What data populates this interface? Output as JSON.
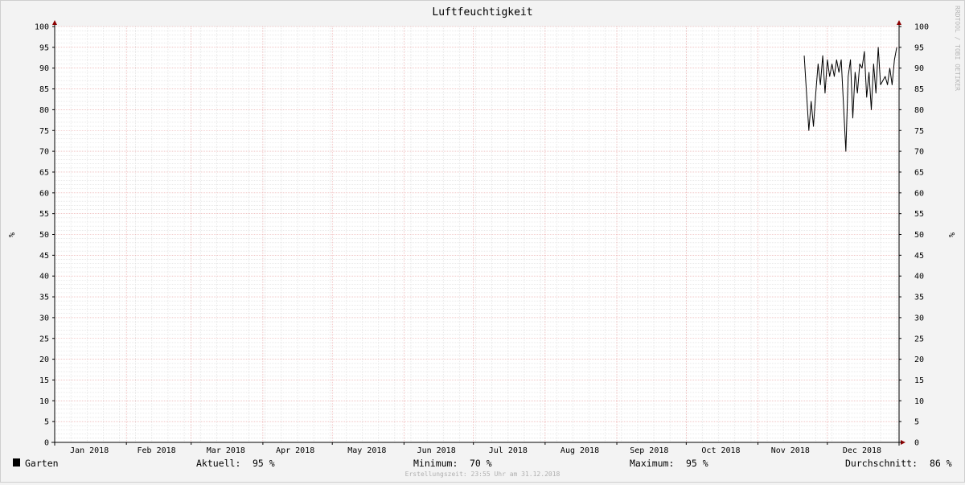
{
  "chart_data": {
    "type": "line",
    "title": "Luftfeuchtigkeit",
    "ylabel": "%",
    "ylabel_right": "%",
    "ylim": [
      0,
      100
    ],
    "yticks": [
      0,
      5,
      10,
      15,
      20,
      25,
      30,
      35,
      40,
      45,
      50,
      55,
      60,
      65,
      70,
      75,
      80,
      85,
      90,
      95,
      100
    ],
    "x_range": [
      "2018-01-01",
      "2019-01-01"
    ],
    "x_ticks": [
      {
        "label": "Jan 2018",
        "date": "2018-01-16"
      },
      {
        "label": "Feb 2018",
        "date": "2018-02-14"
      },
      {
        "label": "Mar 2018",
        "date": "2018-03-16"
      },
      {
        "label": "Apr 2018",
        "date": "2018-04-15"
      },
      {
        "label": "May 2018",
        "date": "2018-05-16"
      },
      {
        "label": "Jun 2018",
        "date": "2018-06-15"
      },
      {
        "label": "Jul 2018",
        "date": "2018-07-16"
      },
      {
        "label": "Aug 2018",
        "date": "2018-08-16"
      },
      {
        "label": "Sep 2018",
        "date": "2018-09-15"
      },
      {
        "label": "Oct 2018",
        "date": "2018-10-16"
      },
      {
        "label": "Nov 2018",
        "date": "2018-11-15"
      },
      {
        "label": "Dec 2018",
        "date": "2018-12-16"
      }
    ],
    "month_starts": [
      "2018-02-01",
      "2018-03-01",
      "2018-04-01",
      "2018-05-01",
      "2018-06-01",
      "2018-07-01",
      "2018-08-01",
      "2018-09-01",
      "2018-10-01",
      "2018-11-01",
      "2018-12-01"
    ],
    "grid": true,
    "series": [
      {
        "name": "Garten",
        "color": "#000000",
        "x": [
          "2018-11-21",
          "2018-11-22",
          "2018-11-23",
          "2018-11-24",
          "2018-11-25",
          "2018-11-26",
          "2018-11-27",
          "2018-11-28",
          "2018-11-29",
          "2018-11-30",
          "2018-12-01",
          "2018-12-02",
          "2018-12-03",
          "2018-12-04",
          "2018-12-05",
          "2018-12-06",
          "2018-12-07",
          "2018-12-08",
          "2018-12-09",
          "2018-12-10",
          "2018-12-11",
          "2018-12-12",
          "2018-12-13",
          "2018-12-14",
          "2018-12-15",
          "2018-12-16",
          "2018-12-17",
          "2018-12-18",
          "2018-12-19",
          "2018-12-20",
          "2018-12-21",
          "2018-12-22",
          "2018-12-23",
          "2018-12-24",
          "2018-12-25",
          "2018-12-26",
          "2018-12-27",
          "2018-12-28",
          "2018-12-29",
          "2018-12-30",
          "2018-12-31"
        ],
        "values": [
          93,
          84,
          75,
          82,
          76,
          84,
          91,
          86,
          93,
          84,
          92,
          88,
          91,
          88,
          92,
          89,
          92,
          81,
          70,
          88,
          92,
          78,
          89,
          84,
          91,
          90,
          94,
          83,
          89,
          80,
          91,
          84,
          95,
          86,
          87,
          88,
          86,
          90,
          86,
          92,
          95
        ]
      }
    ]
  },
  "legend": {
    "series_name": "Garten",
    "swatch_color": "#000000",
    "aktuell_label": "Aktuell:",
    "aktuell_value": "95 %",
    "minimum_label": "Minimum:",
    "minimum_value": "70 %",
    "maximum_label": "Maximum:",
    "maximum_value": "95 %",
    "durchschnitt_label": "Durchschnitt:",
    "durchschnitt_value": "86 %"
  },
  "footer": "Erstellungszeit: 23:55 Uhr am 31.12.2018",
  "watermark": "RRDTOOL / TOBI OETIKER",
  "colors": {
    "background": "#f3f3f3",
    "plot_background": "#ffffff",
    "major_grid": "#e8a0a0",
    "minor_grid": "#dcdcdc",
    "axis_arrow": "#8b0000"
  }
}
